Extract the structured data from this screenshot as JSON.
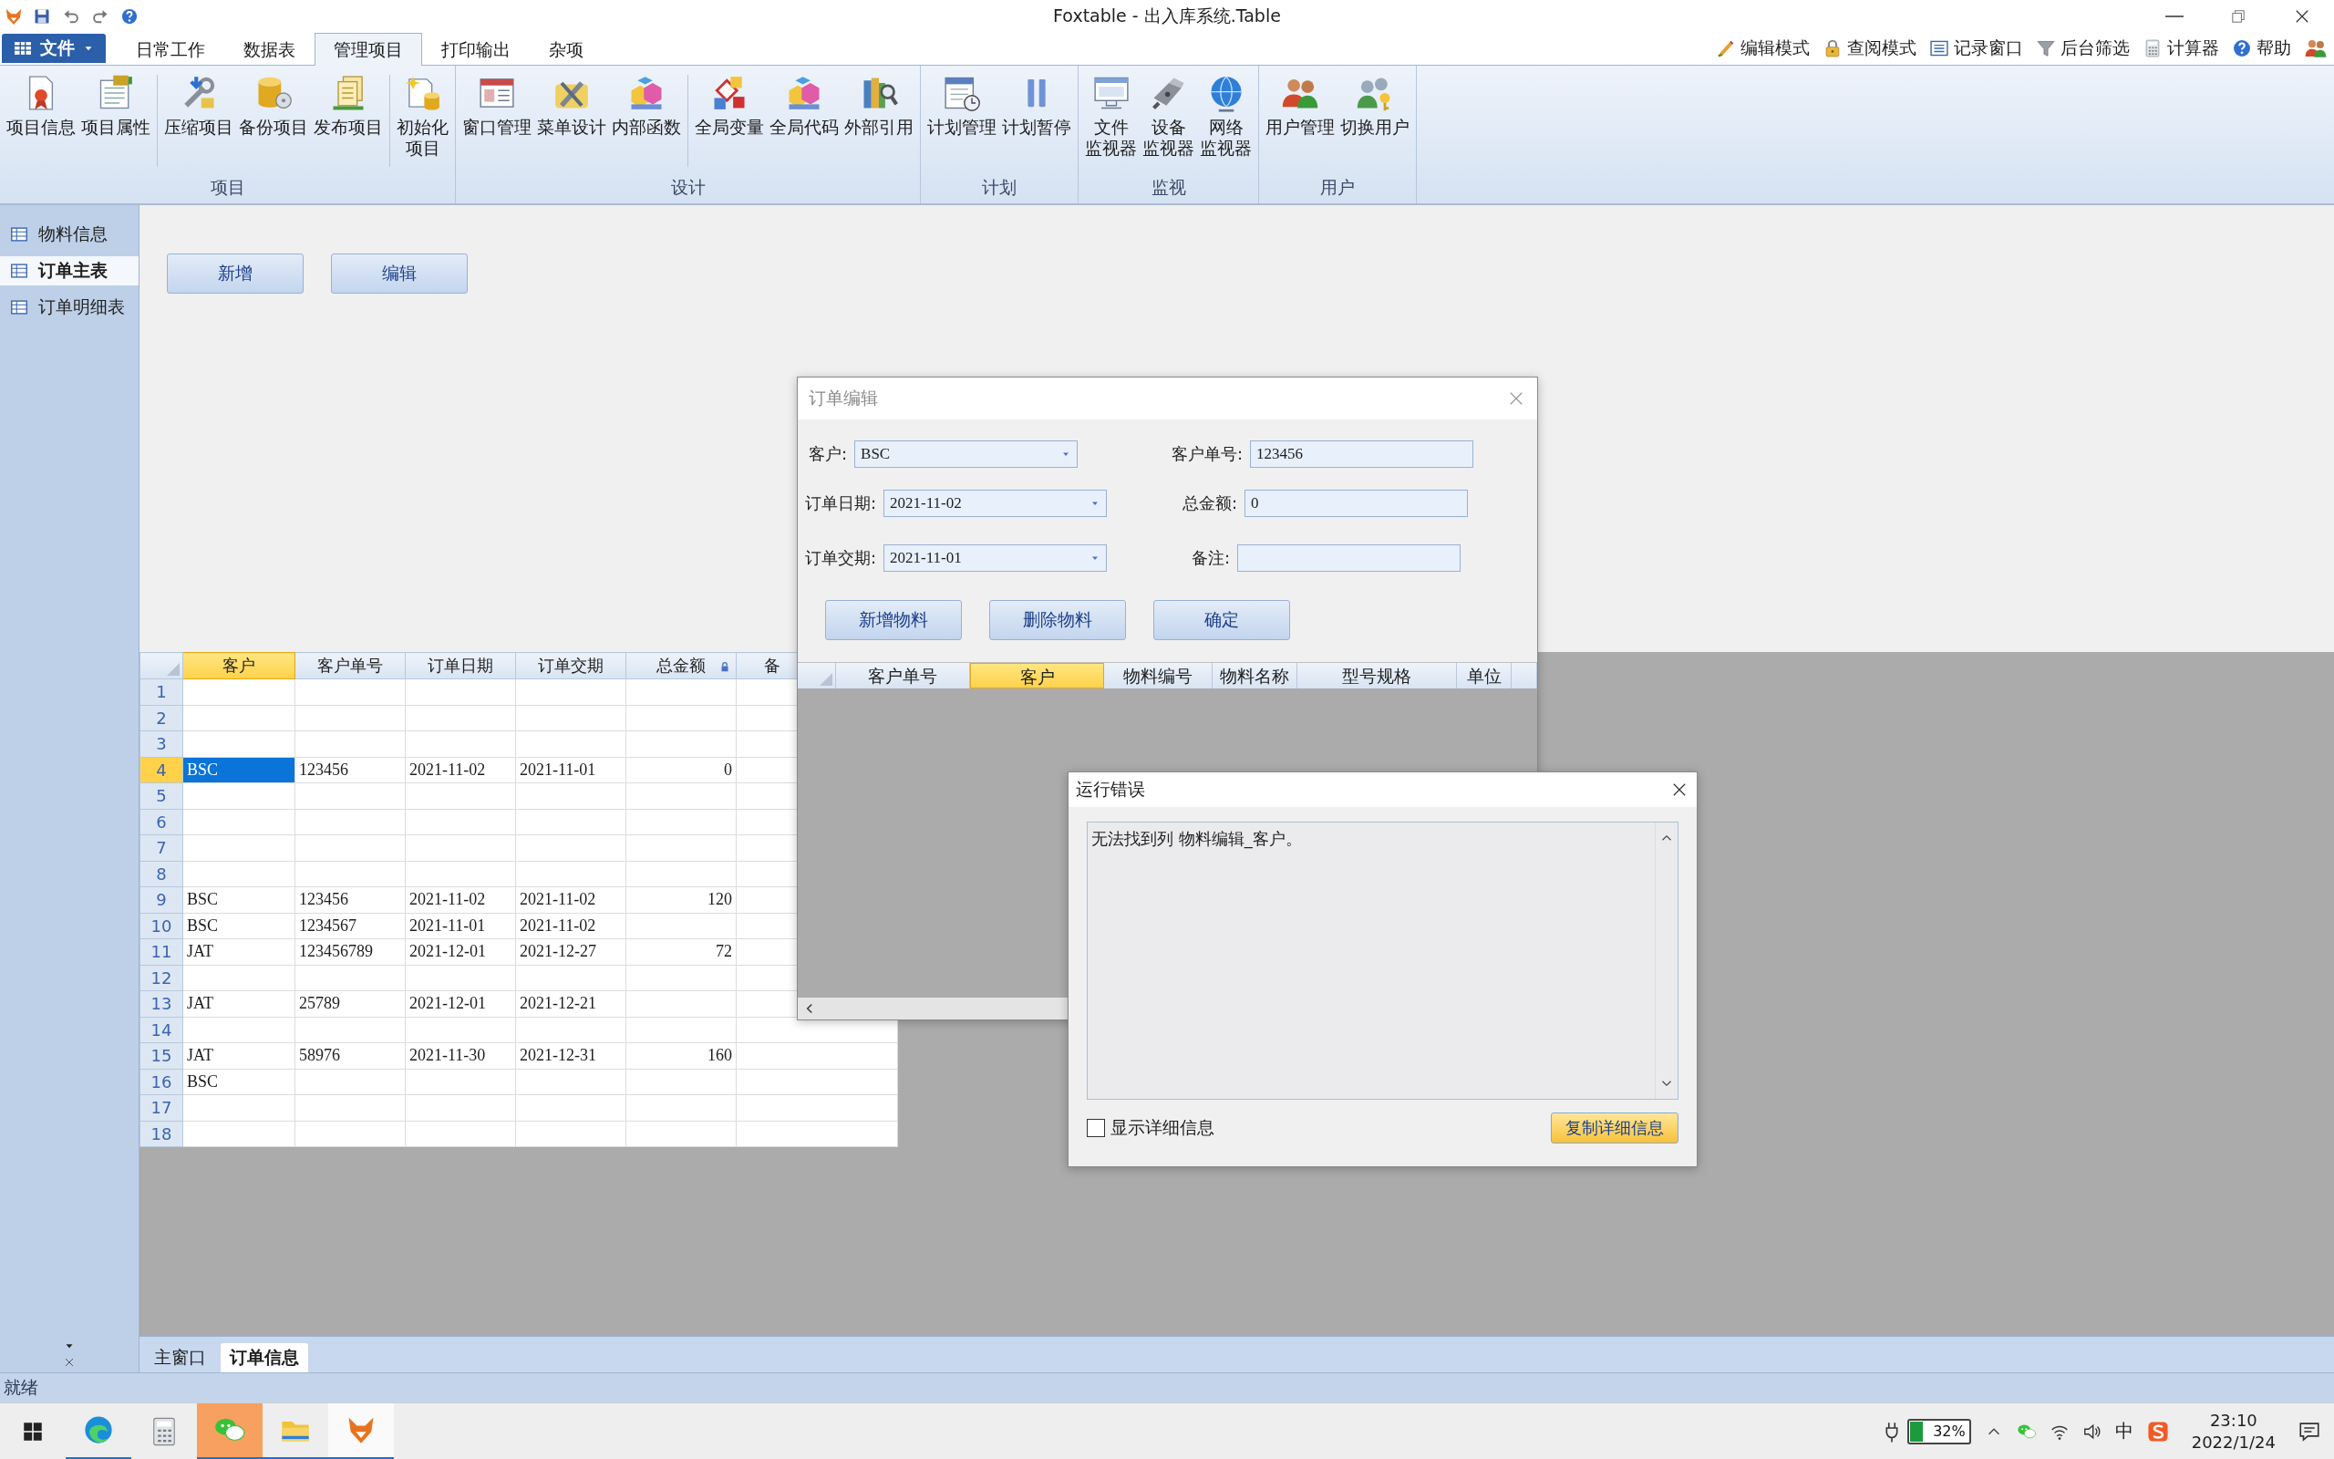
{
  "window": {
    "title": "Foxtable - 出入库系统.Table"
  },
  "menu": {
    "file_button": "文件",
    "tabs": [
      {
        "label": "日常工作",
        "selected": false
      },
      {
        "label": "数据表",
        "selected": false
      },
      {
        "label": "管理项目",
        "selected": true
      },
      {
        "label": "打印输出",
        "selected": false
      },
      {
        "label": "杂项",
        "selected": false
      }
    ],
    "tools": [
      "编辑模式",
      "查阅模式",
      "记录窗口",
      "后台筛选",
      "计算器",
      "帮助"
    ]
  },
  "ribbon": {
    "groups": [
      {
        "title": "项目",
        "sets": [
          [
            [
              "项目信息"
            ],
            [
              "项目属性"
            ]
          ],
          [
            [
              "压缩项目"
            ],
            [
              "备份项目"
            ],
            [
              "发布项目"
            ]
          ],
          [
            [
              "初始化",
              "项目"
            ]
          ]
        ]
      },
      {
        "title": "设计",
        "sets": [
          [
            [
              "窗口管理"
            ],
            [
              "菜单设计"
            ],
            [
              "内部函数"
            ]
          ],
          [
            [
              "全局变量"
            ],
            [
              "全局代码"
            ],
            [
              "外部引用"
            ]
          ]
        ]
      },
      {
        "title": "计划",
        "sets": [
          [
            [
              "计划管理"
            ],
            [
              "计划暂停"
            ]
          ]
        ]
      },
      {
        "title": "监视",
        "sets": [
          [
            [
              "文件",
              "监视器"
            ],
            [
              "设备",
              "监视器"
            ],
            [
              "网络",
              "监视器"
            ]
          ]
        ]
      },
      {
        "title": "用户",
        "sets": [
          [
            [
              "用户管理"
            ],
            [
              "切换用户"
            ]
          ]
        ]
      }
    ]
  },
  "sidebar": {
    "items": [
      {
        "label": "物料信息",
        "selected": false
      },
      {
        "label": "订单主表",
        "selected": true
      },
      {
        "label": "订单明细表",
        "selected": false
      }
    ]
  },
  "toolbar": {
    "buttons": [
      "新增",
      "编辑"
    ]
  },
  "table": {
    "columns": [
      {
        "label": "客户",
        "selected": true,
        "locked": false,
        "kind": "text"
      },
      {
        "label": "客户单号",
        "selected": false,
        "locked": false,
        "kind": "text"
      },
      {
        "label": "订单日期",
        "selected": false,
        "locked": false,
        "kind": "text"
      },
      {
        "label": "订单交期",
        "selected": false,
        "locked": false,
        "kind": "text"
      },
      {
        "label": "总金额",
        "selected": false,
        "locked": true,
        "kind": "number"
      },
      {
        "label": "备",
        "selected": false,
        "locked": false,
        "kind": "text"
      }
    ],
    "rows": [
      {
        "number": "1",
        "selected": false
      },
      {
        "number": "2",
        "selected": false
      },
      {
        "number": "3",
        "selected": false
      },
      {
        "number": "4",
        "selected": true,
        "cells": [
          "BSC",
          "123456",
          "2021-11-02",
          "2021-11-01",
          "0"
        ]
      },
      {
        "number": "5",
        "selected": false
      },
      {
        "number": "6",
        "selected": false
      },
      {
        "number": "7",
        "selected": false
      },
      {
        "number": "8",
        "selected": false
      },
      {
        "number": "9",
        "selected": false,
        "cells": [
          "BSC",
          "123456",
          "2021-11-02",
          "2021-11-02",
          "120"
        ]
      },
      {
        "number": "10",
        "selected": false,
        "cells": [
          "BSC",
          "1234567",
          "2021-11-01",
          "2021-11-02"
        ]
      },
      {
        "number": "11",
        "selected": false,
        "cells": [
          "JAT",
          "123456789",
          "2021-12-01",
          "2021-12-27",
          "72"
        ]
      },
      {
        "number": "12",
        "selected": false
      },
      {
        "number": "13",
        "selected": false,
        "cells": [
          "JAT",
          "25789",
          "2021-12-01",
          "2021-12-21"
        ]
      },
      {
        "number": "14",
        "selected": false
      },
      {
        "number": "15",
        "selected": false,
        "cells": [
          "JAT",
          "58976",
          "2021-11-30",
          "2021-12-31",
          "160"
        ]
      },
      {
        "number": "16",
        "selected": false,
        "cells": [
          "BSC"
        ]
      },
      {
        "number": "17",
        "selected": false
      },
      {
        "number": "18",
        "selected": false
      }
    ]
  },
  "bottom_tabs": [
    {
      "label": "主窗口",
      "selected": false
    },
    {
      "label": "订单信息",
      "selected": true
    }
  ],
  "status_bar": {
    "text": "就绪"
  },
  "order_dialog": {
    "title": "订单编辑",
    "fields": [
      {
        "label": "客户:",
        "value": "BSC",
        "kind": "combo"
      },
      {
        "label": "客户单号:",
        "value": "123456",
        "kind": "text"
      },
      {
        "label": "订单日期:",
        "value": "2021-11-02",
        "kind": "combo"
      },
      {
        "label": "总金额:",
        "value": "0",
        "kind": "text"
      },
      {
        "label": "订单交期:",
        "value": "2021-11-01",
        "kind": "combo"
      },
      {
        "label": "备注:",
        "kind": "text"
      }
    ],
    "buttons": [
      "新增物料",
      "删除物料",
      "确定"
    ],
    "grid": {
      "columns": [
        {
          "label": "客户单号",
          "selected": false
        },
        {
          "label": "客户",
          "selected": true
        },
        {
          "label": "物料编号",
          "selected": false
        },
        {
          "label": "物料名称",
          "selected": false
        },
        {
          "label": "型号规格",
          "selected": false
        },
        {
          "label": "单位",
          "selected": false
        }
      ]
    }
  },
  "error_dialog": {
    "title": "运行错误",
    "message": "无法找到列 物料编辑_客户。",
    "checkbox": {
      "label": "显示详细信息",
      "checked": false
    },
    "button": "复制详细信息"
  },
  "taskbar": {
    "apps": [
      {
        "running": true,
        "selected": false,
        "flashing": false
      },
      {
        "running": false,
        "selected": false,
        "flashing": false
      },
      {
        "running": true,
        "selected": false,
        "flashing": true
      },
      {
        "running": true,
        "selected": false,
        "flashing": false
      },
      {
        "running": true,
        "selected": true,
        "flashing": false
      }
    ],
    "tray": {
      "battery": "32%",
      "ime": "中",
      "time": "23:10",
      "date": "2022/1/24"
    }
  }
}
